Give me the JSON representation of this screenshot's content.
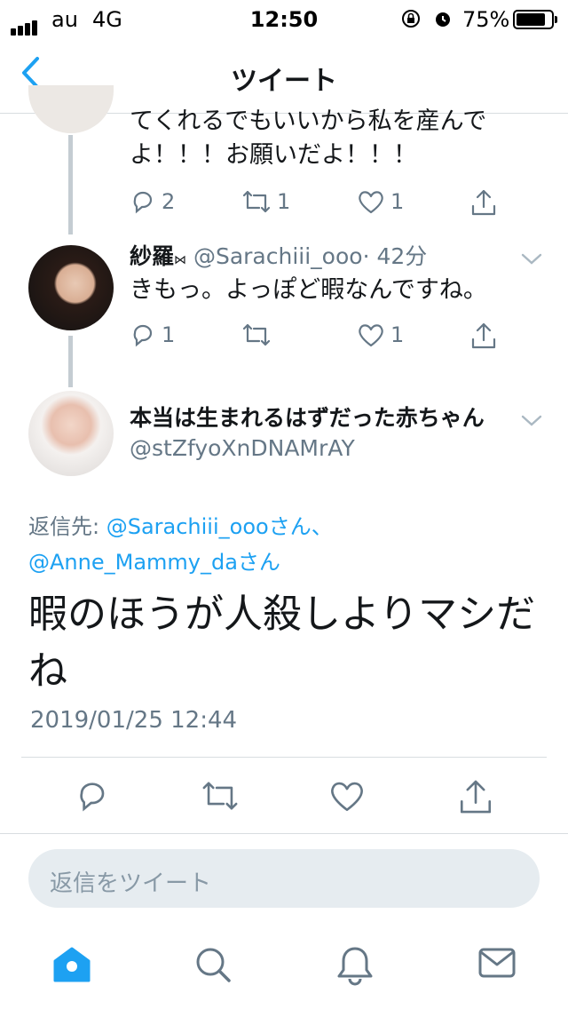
{
  "status_bar": {
    "carrier": "au",
    "network": "4G",
    "time": "12:50",
    "battery": "75%",
    "battery_level": 0.75
  },
  "nav": {
    "title": "ツイート",
    "back_icon": "chevron-left-icon"
  },
  "tweets": [
    {
      "text_lines": [
        "てくれるでもいいから私を産んで",
        "よ！！！お願いだよ！！！"
      ],
      "reply_count": "2",
      "retweet_count": "1",
      "like_count": "1"
    },
    {
      "name": "紗羅",
      "name_emoji": "⋈",
      "handle": "@Sarachiii_ooo",
      "time": "· 42分",
      "text": "きもっ。よっぽど暇なんですね。",
      "reply_count": "1",
      "retweet_count": "",
      "like_count": "1"
    }
  ],
  "main_tweet": {
    "name": "本当は生まれるはずだった赤ちゃん",
    "handle": "@stZfyoXnDNAMrAY",
    "reply_label": "返信先: ",
    "reply_user1": "@Sarachiii_oooさん、",
    "reply_user2": "@Anne_Mammy_daさん",
    "text_lines": [
      "暇のほうが人殺しよりマシだ",
      "ね"
    ],
    "date": "2019/01/25 12:44"
  },
  "compose": {
    "placeholder": "返信をツイート"
  },
  "tabs": [
    "home-icon",
    "search-icon",
    "notifications-icon",
    "messages-icon"
  ],
  "colors": {
    "accent": "#1da1f2",
    "muted": "#657786",
    "divider": "#d8dde0"
  }
}
